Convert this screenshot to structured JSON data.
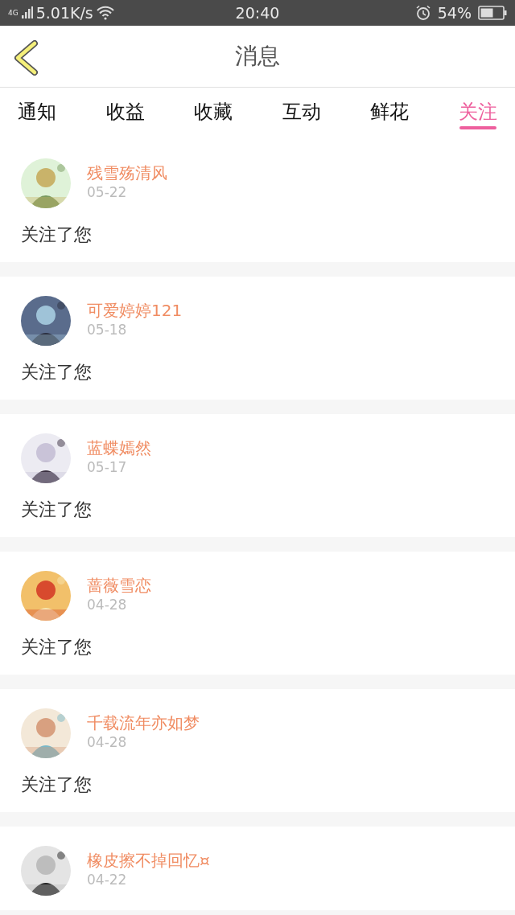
{
  "status_bar": {
    "network": "4G",
    "speed": "5.01K/s",
    "time": "20:40",
    "battery": "54%"
  },
  "header": {
    "title": "消息"
  },
  "tabs": [
    {
      "label": "通知",
      "selected": false
    },
    {
      "label": "收益",
      "selected": false
    },
    {
      "label": "收藏",
      "selected": false
    },
    {
      "label": "互动",
      "selected": false
    },
    {
      "label": "鲜花",
      "selected": false
    },
    {
      "label": "关注",
      "selected": true
    }
  ],
  "messages": [
    {
      "name": "残雪殇清风",
      "date": "05-22",
      "text": "关注了您"
    },
    {
      "name": "可爱婷婷121",
      "date": "05-18",
      "text": "关注了您"
    },
    {
      "name": "蓝蝶嫣然",
      "date": "05-17",
      "text": "关注了您"
    },
    {
      "name": "蔷薇雪恋",
      "date": "04-28",
      "text": "关注了您"
    },
    {
      "name": "千载流年亦如梦",
      "date": "04-28",
      "text": "关注了您"
    },
    {
      "name": "橡皮擦不掉回忆¤",
      "date": "04-22"
    }
  ]
}
